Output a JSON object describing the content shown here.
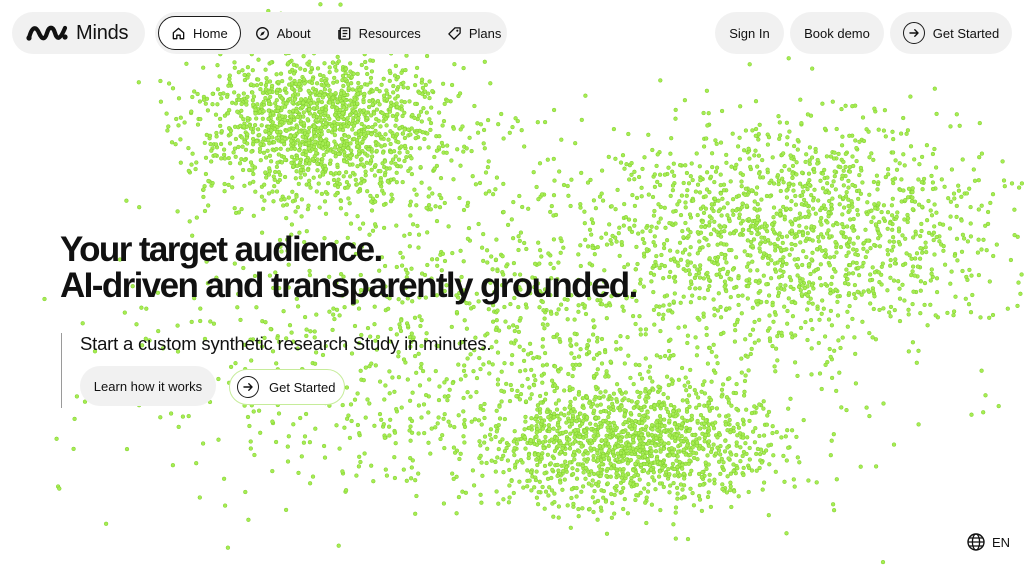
{
  "brand": {
    "name": "Minds"
  },
  "nav": {
    "items": [
      {
        "label": "Home",
        "icon": "home-icon",
        "active": true
      },
      {
        "label": "About",
        "icon": "compass-icon",
        "active": false
      },
      {
        "label": "Resources",
        "icon": "newspaper-icon",
        "active": false
      },
      {
        "label": "Plans",
        "icon": "tag-icon",
        "active": false
      }
    ],
    "sign_in": "Sign In",
    "book_demo": "Book demo",
    "get_started": "Get Started"
  },
  "hero": {
    "title_line1": "Your target audience.",
    "title_line2": "AI-driven and transparently grounded.",
    "subtitle": "Start a custom synthetic research Study in minutes.",
    "learn_button": "Learn how it works",
    "start_button": "Get Started"
  },
  "footer": {
    "language": "EN",
    "language_icon": "globe-icon"
  },
  "colors": {
    "text": "#111111",
    "pill_background": "#f1f1f1",
    "particle_fill": "#a6ec52",
    "particle_stroke": "#7fcf2d",
    "start_button_border": "#c6ec9a"
  }
}
